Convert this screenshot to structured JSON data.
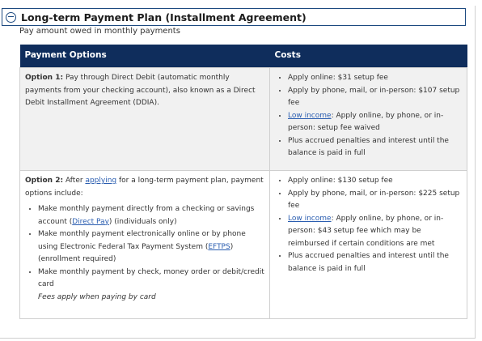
{
  "section": {
    "title": "Long-term Payment Plan (Installment Agreement)",
    "subtitle": "Pay amount owed in monthly payments"
  },
  "table": {
    "headers": [
      "Payment Options",
      "Costs"
    ],
    "row1": {
      "option_label": "Option 1:",
      "option_text": "Pay through Direct Debit (automatic monthly payments from your checking account), also known as a Direct Debit Installment Agreement (DDIA).",
      "costs": {
        "c1": "Apply online: $31 setup fee",
        "c2": "Apply by phone, mail, or in-person: $107 setup fee",
        "c3_link": "Low income",
        "c3_text": ": Apply online, by phone, or in-person: setup fee waived",
        "c4": "Plus accrued penalties and interest until the balance is paid in full"
      }
    },
    "row2": {
      "option_label": "Option 2:",
      "intro_before": "After ",
      "intro_link": "applying",
      "intro_after": " for a long-term payment plan, payment options include:",
      "items": {
        "i1_before": "Make monthly payment directly from a checking or savings account (",
        "i1_link": "Direct Pay",
        "i1_after": ") (individuals only)",
        "i2_before": "Make monthly payment electronically online or by phone using Electronic Federal Tax Payment System (",
        "i2_link": "EFTPS",
        "i2_after": ") (enrollment required)",
        "i3": "Make monthly payment by check, money order or debit/credit card"
      },
      "note": "Fees apply when paying by card",
      "costs": {
        "c1": "Apply online: $130 setup fee",
        "c2": "Apply by phone, mail, or in-person: $225 setup fee",
        "c3_link": "Low income",
        "c3_text": ": Apply online, by phone, or in-person: $43 setup fee which may be reimbursed if certain conditions are met",
        "c4": "Plus accrued penalties and interest until the balance is paid in full"
      }
    }
  },
  "colors": {
    "header_bg": "#0f2d5c",
    "link": "#2a5db0",
    "accordion_border": "#1d4a80"
  }
}
